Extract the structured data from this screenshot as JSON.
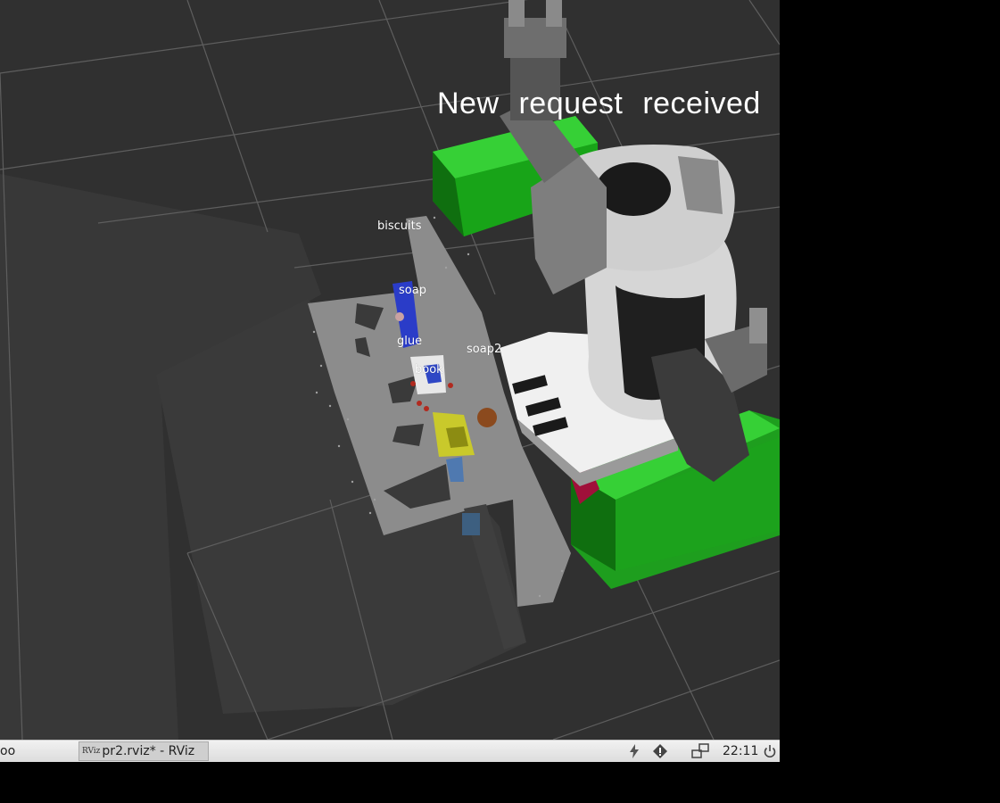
{
  "viewport": {
    "status_text": "New request received",
    "object_labels": {
      "biscuits": "biscuits",
      "soap": "soap",
      "glue": "glue",
      "soap2": "soap2",
      "book": "book"
    },
    "colors": {
      "background": "#303030",
      "grid": "#5a5a5a",
      "table": "#8a8a8a",
      "dropbox": "#1fb51f",
      "robot_body": "#d8d8d8"
    }
  },
  "taskbar": {
    "left_fragment": "oo",
    "window_icon_text": "RViz",
    "window_title": "pr2.rviz* - RViz",
    "clock": "22:11",
    "tray_icons": [
      "power-plug-icon",
      "alert-shield-icon",
      "network-icon",
      "shutdown-icon"
    ]
  }
}
